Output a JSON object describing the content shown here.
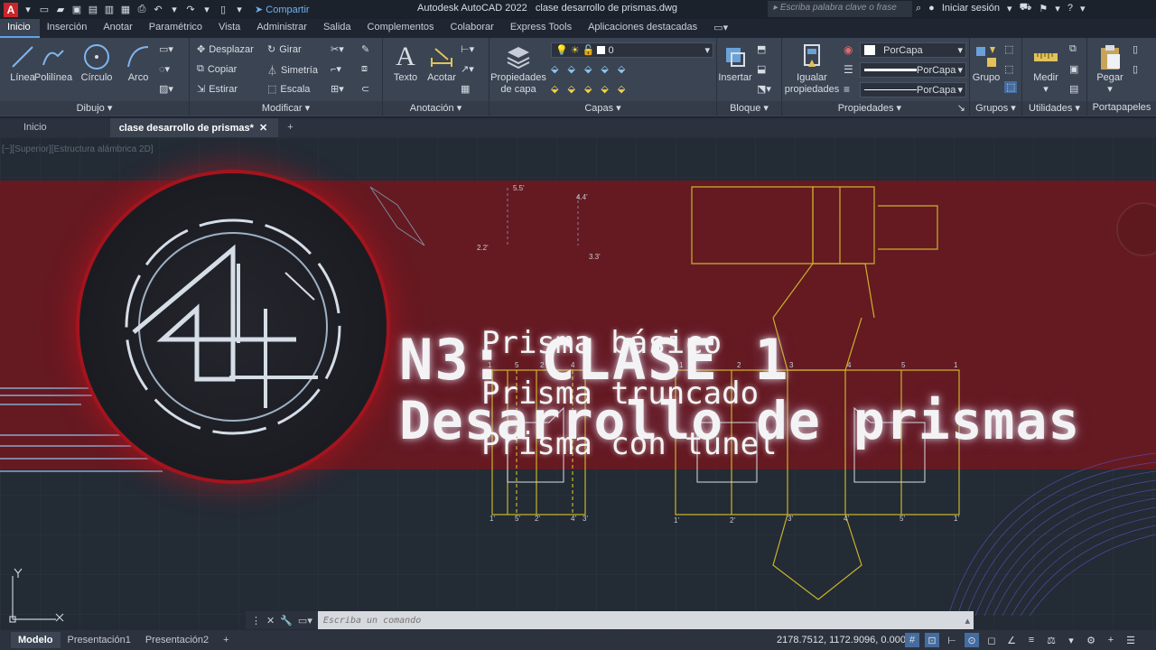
{
  "app": {
    "title": "Autodesk AutoCAD 2022",
    "file": "clase desarrollo de prismas.dwg",
    "share_label": "Compartir",
    "search_placeholder": "Escriba palabra clave o frase",
    "signin_label": "Iniciar sesión"
  },
  "ribbon_tabs": [
    "Inicio",
    "Inserción",
    "Anotar",
    "Paramétrico",
    "Vista",
    "Administrar",
    "Salida",
    "Complementos",
    "Colaborar",
    "Express Tools",
    "Aplicaciones destacadas"
  ],
  "ribbon": {
    "dibujo": {
      "title": "Dibujo",
      "tools": [
        "Línea",
        "Polilínea",
        "Círculo",
        "Arco"
      ]
    },
    "modificar": {
      "title": "Modificar",
      "tools": [
        "Desplazar",
        "Girar",
        "Copiar",
        "Simetría",
        "Estirar",
        "Escala"
      ]
    },
    "anotacion": {
      "title": "Anotación",
      "tools": [
        "Texto",
        "Acotar"
      ]
    },
    "capas": {
      "title": "Capas",
      "props_label": "Propiedades de capa",
      "current_layer": "0"
    },
    "bloque": {
      "title": "Bloque",
      "insert_label": "Insertar"
    },
    "propiedades": {
      "title": "Propiedades",
      "match_label": "Igualar propiedades",
      "color": "PorCapa",
      "linetype": "PorCapa",
      "lineweight": "PorCapa"
    },
    "grupos": {
      "title": "Grupos",
      "group_label": "Grupo"
    },
    "utilidades": {
      "title": "Utilidades",
      "measure_label": "Medir"
    },
    "portapapeles": {
      "title": "Portapapeles",
      "paste_label": "Pegar"
    }
  },
  "doc_tabs": [
    "Inicio",
    "clase desarrollo de prismas*"
  ],
  "viewport_label": "[−][Superior][Estructura alámbrica 2D]",
  "banner": {
    "title_line1": "N3: CLASE 1",
    "title_line2": "Desarrollo de prismas",
    "items": [
      "Prisma básico",
      "Prisma truncado",
      "Prisma con túnel"
    ]
  },
  "command": {
    "placeholder": "Escriba un comando"
  },
  "layout_tabs": [
    "Modelo",
    "Presentación1",
    "Presentación2"
  ],
  "status": {
    "coords": "2178.7512, 1172.9096, 0.0000"
  },
  "drawing_labels": {
    "left_top": [
      "1",
      "5",
      "2",
      "4",
      "3"
    ],
    "left_bottom": [
      "1'",
      "5'",
      "2'",
      "4'",
      "3'"
    ],
    "right_top": [
      "1",
      "2",
      "3",
      "4",
      "5",
      "1"
    ],
    "right_bottom": [
      "1'",
      "2'",
      "3'",
      "4'",
      "5'",
      "1'"
    ],
    "dims": [
      "5.5'",
      "4.4'",
      "3.3'",
      "2.2'"
    ]
  },
  "colors": {
    "accent": "#5ea4e8",
    "banner": "#7a141c",
    "lines": "#c9b42a",
    "ring": "#a4141d"
  }
}
